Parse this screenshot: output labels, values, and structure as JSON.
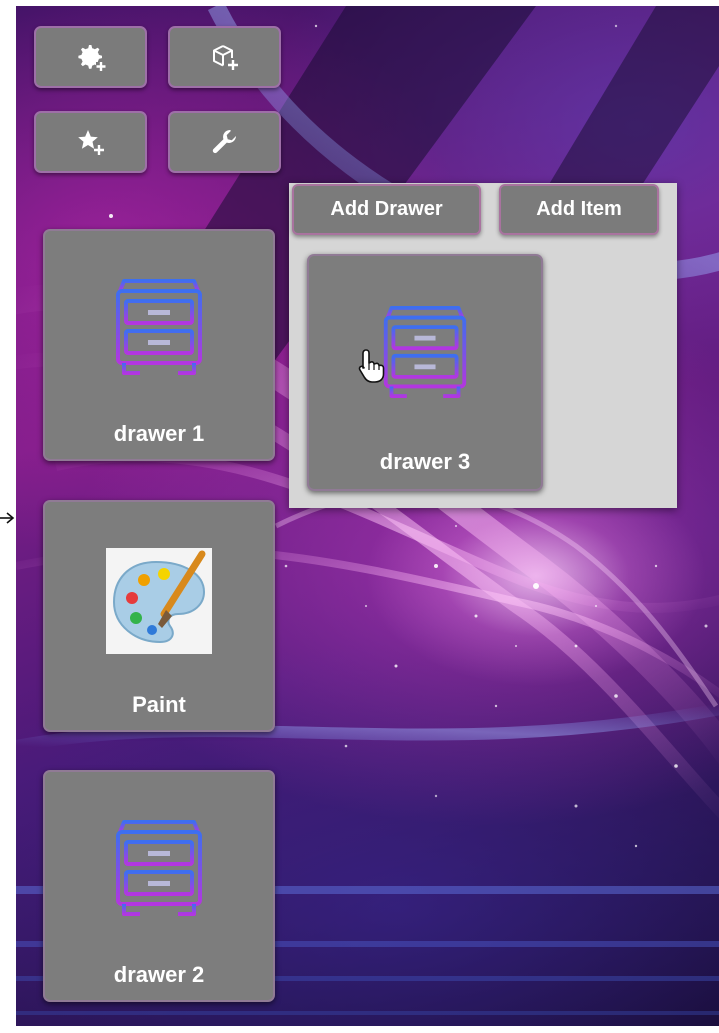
{
  "toolbar": {
    "buttons": [
      {
        "icon": "add-settings-icon"
      },
      {
        "icon": "add-package-icon"
      },
      {
        "icon": "add-favorite-icon"
      },
      {
        "icon": "wrench-icon"
      }
    ]
  },
  "tiles": [
    {
      "label": "drawer 1",
      "icon": "drawer-icon"
    },
    {
      "label": "Paint",
      "icon": "paint-palette-icon"
    },
    {
      "label": "drawer 2",
      "icon": "drawer-icon"
    }
  ],
  "drawer_panel": {
    "add_drawer_label": "Add Drawer",
    "add_item_label": "Add Item",
    "items": [
      {
        "label": "drawer 3",
        "icon": "drawer-icon"
      }
    ]
  },
  "colors": {
    "tile_bg": "#7d7d7d",
    "panel_bg": "#d6d6d6",
    "accent_purple": "#9b3bd6",
    "accent_blue": "#3d6ff0"
  }
}
